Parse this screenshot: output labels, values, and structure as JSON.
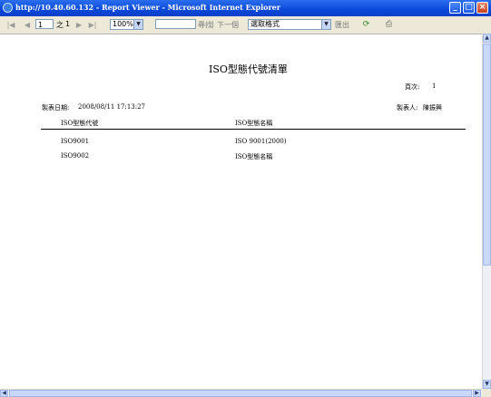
{
  "window": {
    "title": "http://10.40.60.132 - Report Viewer - Microsoft Internet Explorer",
    "minimize_glyph": "_",
    "maximize_glyph": "□",
    "close_glyph": "×"
  },
  "toolbar": {
    "first_glyph": "|◀",
    "prev_glyph": "◀",
    "current_page": "1",
    "of_label": "之",
    "total_pages": "1",
    "next_glyph": "▶",
    "last_glyph": "▶|",
    "zoom": "100%",
    "find_value": "",
    "find_label": "尋找",
    "separator": "|",
    "next_label": "下一個",
    "export_format": "選取格式",
    "export_label": "匯出",
    "refresh_icon": "refresh-icon",
    "print_icon": "print-icon"
  },
  "report": {
    "title": "ISO型態代號清單",
    "page_label": "頁次:",
    "page_value": "1",
    "date_label": "製表日期:",
    "date_value": "2008/08/11 17:13:27",
    "author_label": "製表人:",
    "author_value": "陳振興",
    "columns": [
      "ISO型態代號",
      "ISO型態名稱"
    ],
    "rows": [
      [
        "ISO9001",
        "ISO 9001(2000)"
      ],
      [
        "ISO9002",
        "ISO型態名稱"
      ]
    ]
  }
}
